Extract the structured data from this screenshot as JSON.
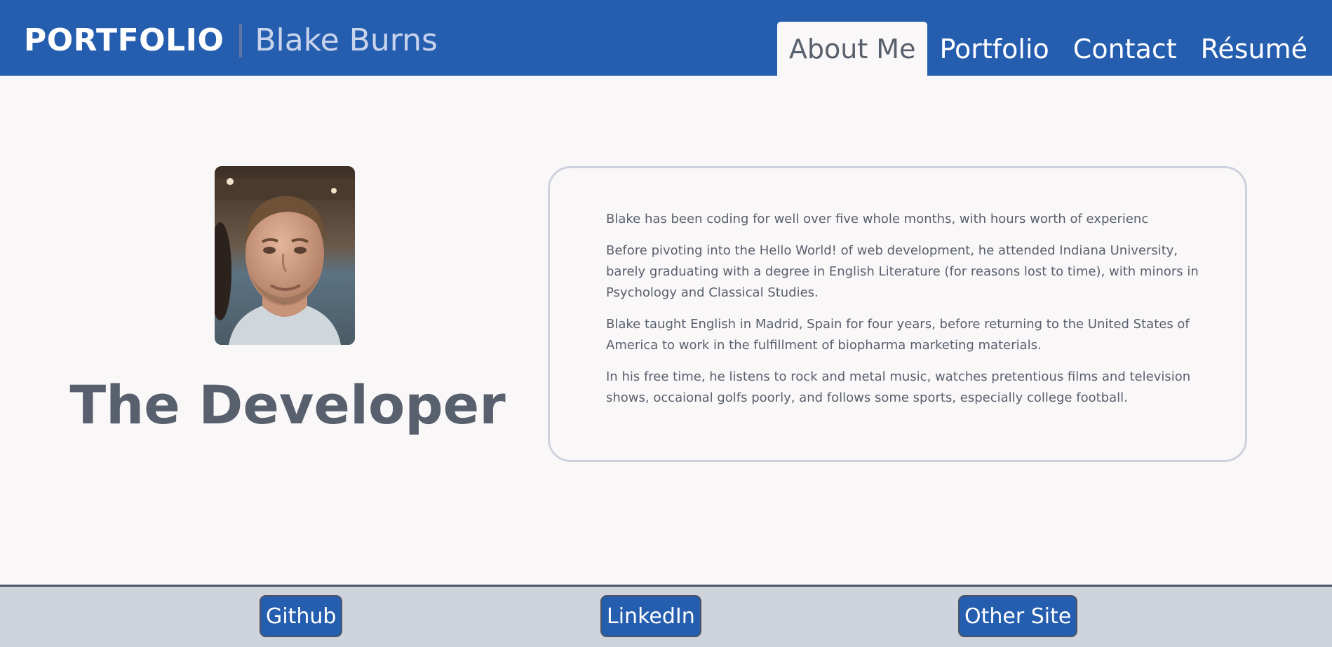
{
  "header": {
    "title": "PORTFOLIO",
    "name": "Blake Burns",
    "nav": [
      {
        "label": "About Me",
        "active": true
      },
      {
        "label": "Portfolio",
        "active": false
      },
      {
        "label": "Contact",
        "active": false
      },
      {
        "label": "Résumé",
        "active": false
      }
    ]
  },
  "main": {
    "heading": "The Developer",
    "photo_icon": "profile-photo",
    "paragraphs": [
      "Blake has been coding for well over five whole months, with hours worth of experienc",
      "Before pivoting into the Hello World! of web development, he attended Indiana University,\nbarely graduating with a degree in English Literature (for reasons lost to time), with minors in\nPsychology and Classical Studies.",
      "Blake taught English in Madrid, Spain for four years, before returning to the United States of\nAmerica to work in the fulfillment of biopharma marketing materials.",
      "In his free time, he listens to rock and metal music, watches pretentious films and television\nshows, occaional golfs poorly, and follows some sports, especially college football."
    ]
  },
  "footer": {
    "links": [
      "Github",
      "LinkedIn",
      "Other Site"
    ]
  },
  "colors": {
    "header_bg": "#265eaf",
    "page_bg": "#faf7f8",
    "text": "#58606d",
    "footer_bg": "#cfd3dc"
  }
}
